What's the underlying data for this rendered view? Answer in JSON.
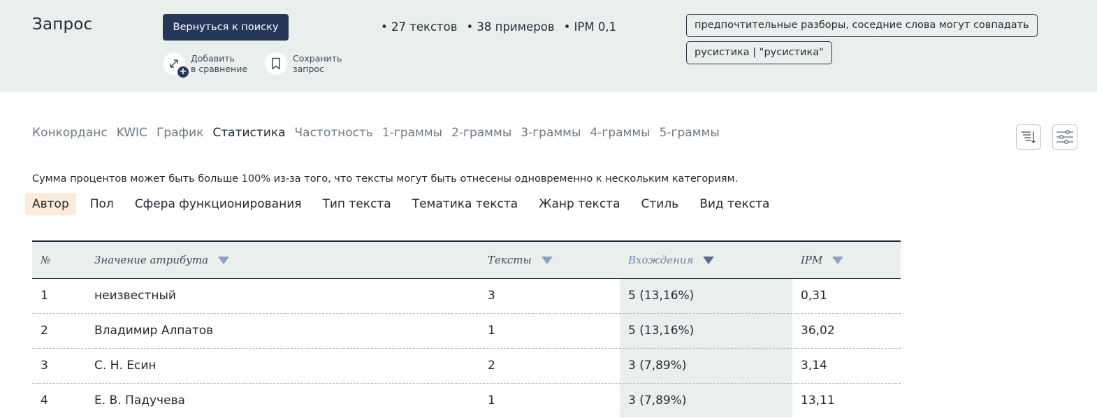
{
  "header": {
    "title": "Запрос",
    "back_button": "Вернуться к поиску",
    "compare_action": {
      "line1": "Добавить",
      "line2": "в сравнение"
    },
    "save_action": {
      "line1": "Сохранить",
      "line2": "запрос"
    },
    "stats": [
      "• 27 текстов",
      "• 38 примеров",
      "• IPM 0,1"
    ],
    "chips": [
      "предпочтительные разборы, соседние слова могут совпадать",
      "русистика | \"русистика\""
    ]
  },
  "view_tabs": [
    "Конкорданс",
    "KWIC",
    "График",
    "Статистика",
    "Частотность",
    "1-граммы",
    "2-граммы",
    "3-граммы",
    "4-граммы",
    "5-граммы"
  ],
  "active_view_tab": "Статистика",
  "note": "Сумма процентов может быть больше 100% из-за того, что тексты могут быть отнесены одновременно к нескольким категориям.",
  "category_tabs": [
    "Автор",
    "Пол",
    "Сфера функционирования",
    "Тип текста",
    "Тематика текста",
    "Жанр текста",
    "Стиль",
    "Вид текста"
  ],
  "active_category_tab": "Автор",
  "table": {
    "headers": {
      "num": "№",
      "value": "Значение атрибута",
      "texts": "Тексты",
      "occurrences": "Вхождения",
      "ipm": "IPM"
    },
    "sorted_by": "occurrences",
    "rows": [
      {
        "num": "1",
        "value": "неизвестный",
        "texts": "3",
        "occurrences": "5 (13,16%)",
        "ipm": "0,31"
      },
      {
        "num": "2",
        "value": "Владимир Алпатов",
        "texts": "1",
        "occurrences": "5 (13,16%)",
        "ipm": "36,02"
      },
      {
        "num": "3",
        "value": "С. Н. Есин",
        "texts": "2",
        "occurrences": "3 (7,89%)",
        "ipm": "3,14"
      },
      {
        "num": "4",
        "value": "Е. В. Падучева",
        "texts": "1",
        "occurrences": "3 (7,89%)",
        "ipm": "13,11"
      }
    ]
  },
  "icons": {
    "compare": "compare-arrows-icon",
    "save": "bookmark-icon",
    "sort": "sort-lines-icon",
    "settings": "sliders-icon"
  },
  "colors": {
    "header_bg": "#e9efec",
    "primary_button": "#27375a",
    "active_category_bg": "#fdebd9",
    "sorted_header": "#6f87b3"
  }
}
